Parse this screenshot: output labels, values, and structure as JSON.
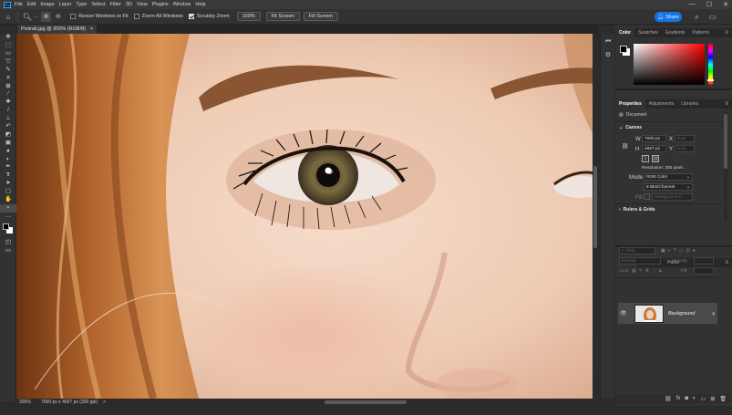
{
  "app": {
    "logo_text": "Ps"
  },
  "menu": [
    "File",
    "Edit",
    "Image",
    "Layer",
    "Type",
    "Select",
    "Filter",
    "3D",
    "View",
    "Plugins",
    "Window",
    "Help"
  ],
  "window_controls": {
    "minimize": "—",
    "maximize": "☐",
    "close": "✕"
  },
  "options": {
    "resize_windows_label": "Resize Windows to Fit",
    "zoom_all_label": "Zoom All Windows",
    "scrubby_zoom_label": "Scrubby Zoom",
    "zoom_value": "100%",
    "fit_screen_label": "Fit Screen",
    "fill_screen_label": "Fill Screen",
    "share_label": "Share",
    "resize_checked": false,
    "zoom_all_checked": false,
    "scrubby_checked": true
  },
  "document": {
    "tab_title": "Portrait.jpg @ 200% (RGB/8)",
    "tab_close": "×"
  },
  "status": {
    "zoom": "200%",
    "info": "7000 px x 4667 px (300 ppi)",
    "arrow": ">"
  },
  "color_panel": {
    "tabs": [
      "Color",
      "Swatches",
      "Gradients",
      "Patterns"
    ],
    "active_tab": "Color",
    "foreground": "#000000",
    "background": "#ffffff"
  },
  "properties_panel": {
    "tabs": [
      "Properties",
      "Adjustments",
      "Libraries"
    ],
    "active_tab": "Properties",
    "type_label": "Document",
    "canvas_section": "Canvas",
    "w_label": "W",
    "w_value": "7000 px",
    "h_label": "H",
    "h_value": "4667 px",
    "x_label": "X",
    "x_value": "0 px",
    "y_label": "Y",
    "y_value": "0 px",
    "resolution": "Resolution: 300 pixel...",
    "mode_label": "Mode",
    "mode_value": "RGB Color",
    "bits_value": "8 Bits/Channel",
    "fill_label": "Fill",
    "fill_value": "Background C...",
    "rulers_section": "Rulers & Grids"
  },
  "layers_panel": {
    "tabs": [
      "Layers",
      "Channels",
      "Paths"
    ],
    "active_tab": "Layers",
    "kind_filter": "Kind",
    "blend_mode": "Normal",
    "opacity_label": "Opacity:",
    "lock_label": "Lock:",
    "fill_label": "Fill:",
    "layers": [
      {
        "name": "Background",
        "visible": true,
        "locked": true
      }
    ]
  },
  "colors": {
    "accent": "#1473e6",
    "panel_bg": "#323232",
    "app_bg": "#2b2b2b"
  }
}
